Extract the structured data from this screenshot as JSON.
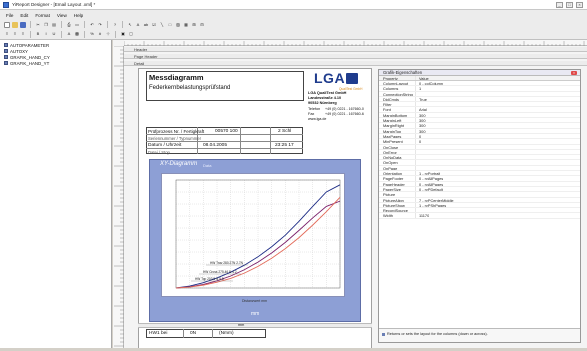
{
  "window": {
    "title": "YiReport Designer - [Email Layout .xml] *",
    "min": "_",
    "max": "□",
    "close": "×"
  },
  "menu": [
    "File",
    "Edit",
    "Format",
    "View",
    "Help"
  ],
  "tree": [
    "AUTOPARAMETER",
    "AUTOXY",
    "GRAFIK_HAND_CY",
    "GRAFIK_HAND_YT"
  ],
  "bands": [
    "Header",
    "Page Header",
    "Detail"
  ],
  "report": {
    "title": "Messdiagramm",
    "subtitle": "Federkernbelastungsprüfstand",
    "logo": "LGA",
    "logo_sub": "QualiTest GmbH",
    "company": [
      "LGA QualiTest GmbH",
      "Landesstraße 4.10",
      "90532 Nürnberg"
    ],
    "contact_rows": [
      [
        "Telefon",
        "+49 (0) 0221 - 167660-0"
      ],
      [
        "Fax",
        "+49 (0) 0221 - 167660-6"
      ]
    ],
    "web": "www.lga.de",
    "rows": [
      [
        "Prüfprozess Nr. / Fertigkraft",
        "00570 100",
        "2 Schl"
      ],
      [
        "Seriennummer / Typnummer",
        "",
        ""
      ],
      [
        "Datum / Uhrzeit",
        "08.04.2005",
        "23:25 17"
      ],
      [
        "Datei / Stop",
        "",
        ""
      ]
    ],
    "chart_title": "XY-Diagramm",
    "chart_title_sub": "Data",
    "xunit": "mm",
    "xlabel": "Distanzwert mm",
    "bottom_band": "mm",
    "footer_cells": [
      "HW1 bei",
      "0N",
      "(Nmm)"
    ],
    "annotations": [
      "HW Trav 280.27N 2.7N",
      "HW Cross 275.46 N 4.2",
      "HW Top 203.5 N 5.8"
    ]
  },
  "chart_data": {
    "type": "line",
    "xlabel": "mm",
    "series": [
      {
        "name": "",
        "color": "#1c2b85",
        "x": [
          0,
          5,
          10,
          15,
          20,
          25,
          30,
          35,
          40,
          45,
          50,
          55,
          60
        ],
        "y": [
          0,
          8,
          22,
          42,
          66,
          95,
          130,
          172,
          220,
          278,
          340,
          400,
          430
        ]
      },
      {
        "name": "",
        "color": "#7a1f6a",
        "x": [
          0,
          5,
          10,
          15,
          20,
          25,
          30,
          35,
          40,
          45,
          50,
          55,
          60
        ],
        "y": [
          0,
          5,
          15,
          30,
          50,
          76,
          108,
          146,
          190,
          240,
          292,
          340,
          362
        ]
      },
      {
        "name": "",
        "color": "#e36b5a",
        "x": [
          0,
          5,
          10,
          15,
          20,
          25,
          30,
          35,
          40,
          45,
          50,
          55,
          60
        ],
        "y": [
          0,
          4,
          12,
          24,
          40,
          62,
          90,
          124,
          164,
          210,
          262,
          318,
          378
        ]
      }
    ],
    "xlim": [
      0,
      60
    ],
    "ylim": [
      0,
      450
    ],
    "grid": true
  },
  "properties": {
    "title": "Grafik-Eigenschaften",
    "header": [
      "Property",
      "Value"
    ],
    "rows": [
      [
        "ColumnLayout",
        "0 - colColumn"
      ],
      [
        "Columns",
        "1"
      ],
      [
        "ConnectionString",
        ""
      ],
      [
        "DidCmds",
        "True"
      ],
      [
        "Filter",
        ""
      ],
      [
        "Font",
        "Arial"
      ],
      [
        "MarginBottom",
        "300"
      ],
      [
        "MarginLeft",
        "300"
      ],
      [
        "MarginRight",
        "300"
      ],
      [
        "MarginTop",
        "300"
      ],
      [
        "MaxPages",
        "0"
      ],
      [
        "MinPresent",
        "0"
      ],
      [
        "OnClose",
        ""
      ],
      [
        "OnError",
        ""
      ],
      [
        "OnNoData",
        ""
      ],
      [
        "OnOpen",
        ""
      ],
      [
        "OnPage",
        ""
      ],
      [
        "Orientation",
        "1 - rvPortrait"
      ],
      [
        "PageFooter",
        "0 - rvAllPages"
      ],
      [
        "PageHeader",
        "0 - rvAllPages"
      ],
      [
        "PaperSize",
        "0 - rvPDefault"
      ],
      [
        "Picture",
        ""
      ],
      [
        "PictureAlign",
        "7 - rvPCenterMiddle"
      ],
      [
        "PictureShow",
        "1 - rvPShPages"
      ],
      [
        "RecordSource",
        ""
      ],
      [
        "Width",
        "11170"
      ]
    ],
    "footer": "Returns or sets the layout for the columns (down or across)."
  }
}
